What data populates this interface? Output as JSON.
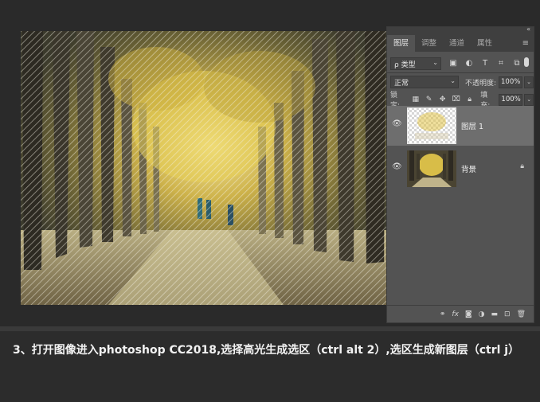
{
  "panel": {
    "tabs": [
      {
        "label": "图层",
        "active": true
      },
      {
        "label": "调整",
        "active": false
      },
      {
        "label": "通道",
        "active": false
      },
      {
        "label": "属性",
        "active": false
      }
    ],
    "collapse_icon": "double-chevron-icon",
    "menu_icon": "panel-menu-icon",
    "filter": {
      "kind_label": "ρ 类型",
      "icons": [
        "image-filter-icon",
        "adjustment-filter-icon",
        "type-filter-icon",
        "shape-filter-icon",
        "smartobject-filter-icon"
      ]
    },
    "blend": {
      "mode": "正常",
      "opacity_label": "不透明度:",
      "opacity_value": "100%"
    },
    "lock": {
      "label": "锁定:",
      "icons": [
        "lock-transparent-icon",
        "lock-image-icon",
        "lock-position-icon",
        "lock-artboard-icon",
        "lock-all-icon"
      ],
      "fill_label": "填充:",
      "fill_value": "100%"
    },
    "layers": [
      {
        "name": "图层 1",
        "selected": true,
        "locked": false
      },
      {
        "name": "背景",
        "selected": false,
        "locked": true
      }
    ],
    "bottom_icons": [
      "link-icon",
      "fx-icon",
      "mask-icon",
      "adjustment-icon",
      "folder-icon",
      "new-layer-icon",
      "trash-icon"
    ]
  },
  "colors": {
    "panel_bg": "#535353",
    "selected_layer": "#6e6e6e",
    "accent_yellow": "#e2c44a"
  },
  "caption": "3、打开图像进入photoshop CC2018,选择高光生成选区（ctrl alt 2）,选区生成新图层（ctrl j）"
}
